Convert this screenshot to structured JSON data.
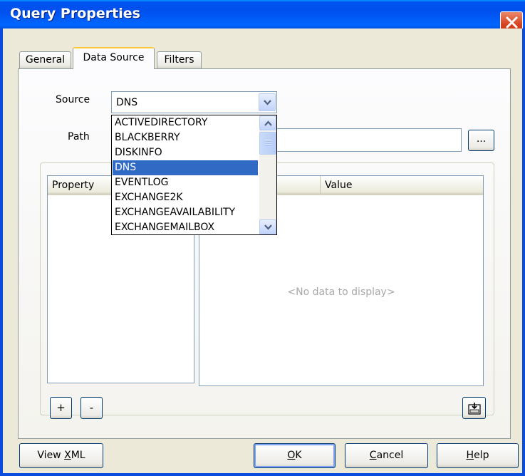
{
  "window": {
    "title": "Query Properties"
  },
  "tabs": [
    {
      "label": "General",
      "active": false
    },
    {
      "label": "Data Source",
      "active": true
    },
    {
      "label": "Filters",
      "active": false
    }
  ],
  "source": {
    "label": "Source",
    "value": "DNS"
  },
  "path": {
    "label": "Path",
    "value": "",
    "browse_label": "..."
  },
  "dropdown": {
    "options": [
      "ACTIVEDIRECTORY",
      "BLACKBERRY",
      "DISKINFO",
      "DNS",
      "EVENTLOG",
      "EXCHANGE2K",
      "EXCHANGEAVAILABILITY",
      "EXCHANGEMAILBOX"
    ],
    "selected": "DNS"
  },
  "property_list": {
    "header": "Property"
  },
  "value_grid": {
    "header": "Value",
    "empty_text": "<No data to display>"
  },
  "buttons": {
    "add": "+",
    "remove": "-",
    "view_xml_pre": "View ",
    "view_xml_u": "X",
    "view_xml_post": "ML",
    "ok_u": "O",
    "ok_post": "K",
    "cancel_u": "C",
    "cancel_post": "ancel",
    "help_u": "H",
    "help_post": "elp"
  },
  "colors": {
    "titlebar": "#0054e3",
    "selection": "#316ac5",
    "tab_highlight": "#ffc83c"
  }
}
